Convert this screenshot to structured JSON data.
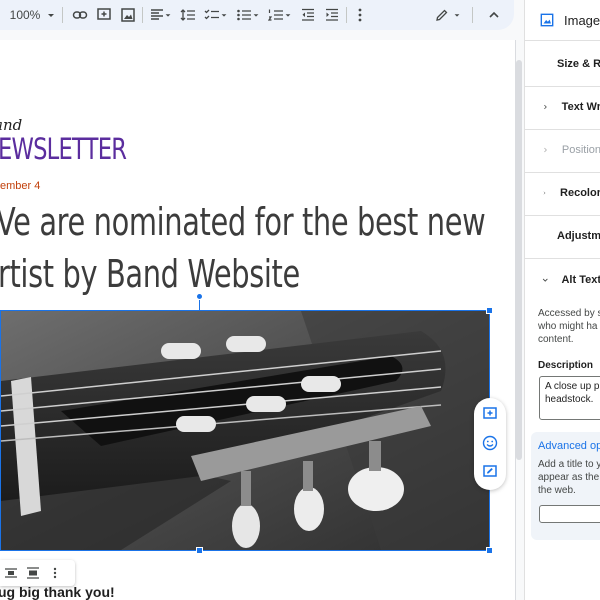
{
  "toolbar": {
    "zoom": "100%"
  },
  "document": {
    "newsletter_script": "and",
    "newsletter_title": "EWSLETTER",
    "date": "ember 4",
    "headline_line1": "Ve are nominated for the best new",
    "headline_line2": "rtist by Band Website",
    "caption": "ug big thank you!"
  },
  "image": {
    "alt": "A close up photo of a guitar headstock."
  },
  "side_panel": {
    "title": "Image",
    "sections": [
      {
        "label": "Size & R",
        "disabled": false
      },
      {
        "label": "Text Wr",
        "disabled": false
      },
      {
        "label": "Position",
        "disabled": true
      },
      {
        "label": "Recolor",
        "disabled": false
      },
      {
        "label": "Adjustm",
        "disabled": false
      }
    ],
    "alt_text": {
      "label": "Alt Text",
      "help_line1": "Accessed by s",
      "help_line2": "who might ha",
      "help_line3": "content.",
      "description_label": "Description",
      "description_line1": "A close up ph",
      "description_line2": "headstock."
    },
    "advanced": {
      "label": "Advanced op",
      "line1": "Add a title to y",
      "line2": "appear as the",
      "line3": "the web."
    }
  },
  "colors": {
    "accent": "#1a73e8",
    "newsletter_purple": "#5b2d9e",
    "date_orange": "#c2410c",
    "headline": "#3c3c3c"
  }
}
